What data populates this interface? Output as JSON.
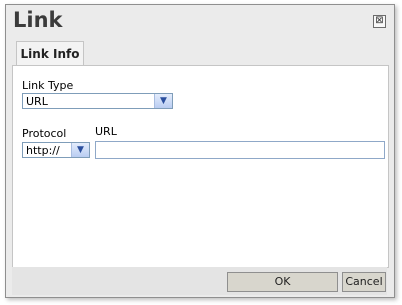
{
  "dialog": {
    "title": "Link",
    "close_symbol": "⊠",
    "close_icon": "close-icon"
  },
  "tabs": [
    {
      "label": "Link Info"
    }
  ],
  "form": {
    "link_type_label": "Link Type",
    "link_type_value": "URL",
    "protocol_label": "Protocol",
    "protocol_value": "http://",
    "url_label": "URL",
    "url_value": "",
    "dropdown_arrow": "▼"
  },
  "buttons": {
    "ok": "OK",
    "cancel": "Cancel"
  }
}
